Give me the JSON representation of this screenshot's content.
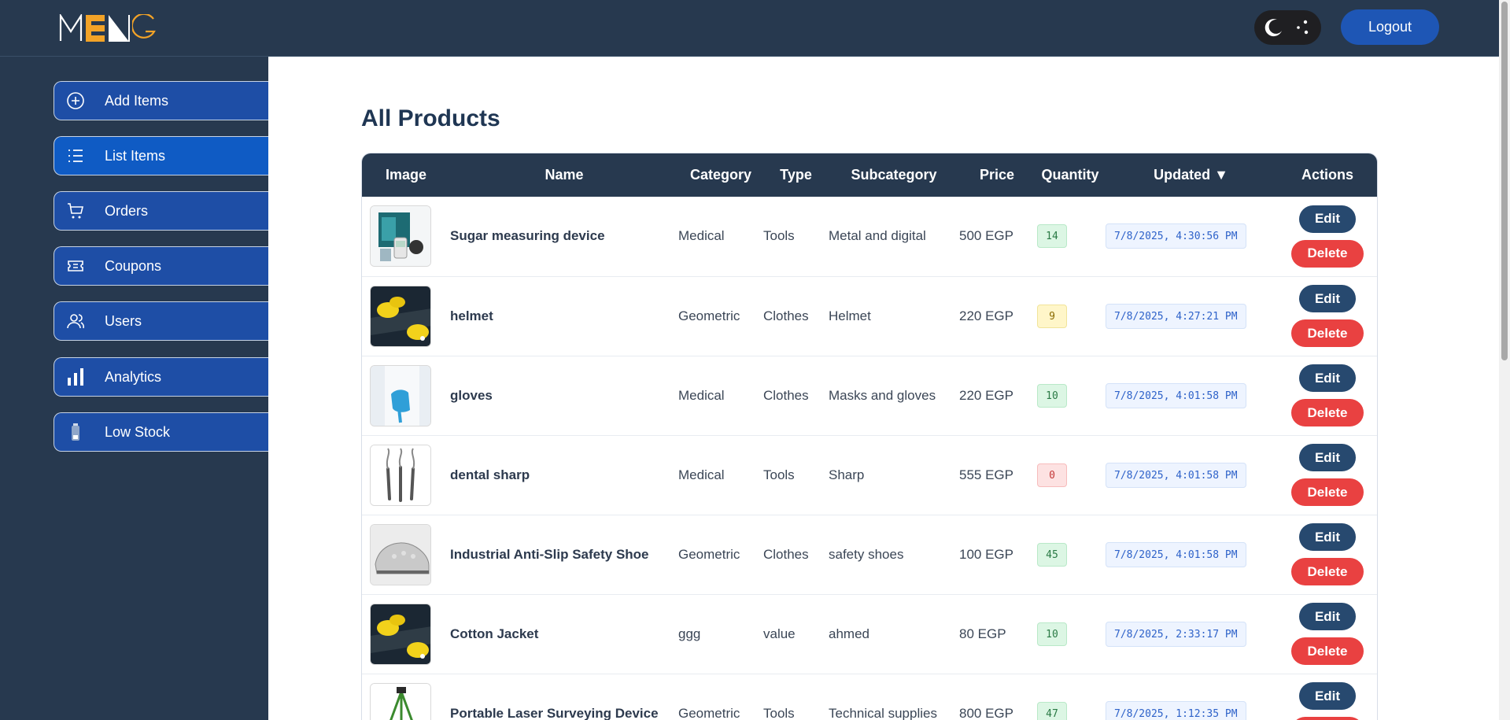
{
  "header": {
    "logout_label": "Logout"
  },
  "sidebar": {
    "items": [
      {
        "label": "Add Items",
        "icon": "plus-circle-icon"
      },
      {
        "label": "List Items",
        "icon": "list-icon"
      },
      {
        "label": "Orders",
        "icon": "cart-icon"
      },
      {
        "label": "Coupons",
        "icon": "ticket-icon"
      },
      {
        "label": "Users",
        "icon": "users-icon"
      },
      {
        "label": "Analytics",
        "icon": "bar-chart-icon"
      },
      {
        "label": "Low Stock",
        "icon": "battery-low-icon"
      }
    ]
  },
  "main": {
    "title": "All Products",
    "columns": [
      "Image",
      "Name",
      "Category",
      "Type",
      "Subcategory",
      "Price",
      "Quantity",
      "Updated ▼",
      "Actions"
    ],
    "edit_label": "Edit",
    "delete_label": "Delete",
    "rows": [
      {
        "name": "Sugar measuring device",
        "category": "Medical",
        "type": "Tools",
        "subcategory": "Metal and digital",
        "price": "500 EGP",
        "quantity": "14",
        "stock": "ok",
        "updated": "7/8/2025, 4:30:56 PM",
        "thumb": "glucometer-kit"
      },
      {
        "name": "helmet",
        "category": "Geometric",
        "type": "Clothes",
        "subcategory": "Helmet",
        "price": "220 EGP",
        "quantity": "9",
        "stock": "low",
        "updated": "7/8/2025, 4:27:21 PM",
        "thumb": "yellow-helmets"
      },
      {
        "name": "gloves",
        "category": "Medical",
        "type": "Clothes",
        "subcategory": "Masks and gloves",
        "price": "220 EGP",
        "quantity": "10",
        "stock": "ok",
        "updated": "7/8/2025, 4:01:58 PM",
        "thumb": "blue-gloves"
      },
      {
        "name": "dental sharp",
        "category": "Medical",
        "type": "Tools",
        "subcategory": "Sharp",
        "price": "555 EGP",
        "quantity": "0",
        "stock": "out",
        "updated": "7/8/2025, 4:01:58 PM",
        "thumb": "dental-tools"
      },
      {
        "name": "Industrial Anti-Slip Safety Shoe",
        "category": "Geometric",
        "type": "Clothes",
        "subcategory": "safety shoes",
        "price": "100 EGP",
        "quantity": "45",
        "stock": "ok",
        "updated": "7/8/2025, 4:01:58 PM",
        "thumb": "safety-shoe"
      },
      {
        "name": "Cotton Jacket",
        "category": "ggg",
        "type": "value",
        "subcategory": "ahmed",
        "price": "80 EGP",
        "quantity": "10",
        "stock": "ok",
        "updated": "7/8/2025, 2:33:17 PM",
        "thumb": "yellow-helmets"
      },
      {
        "name": "Portable Laser Surveying Device",
        "category": "Geometric",
        "type": "Tools",
        "subcategory": "Technical supplies",
        "price": "800 EGP",
        "quantity": "47",
        "stock": "ok",
        "updated": "7/8/2025, 1:12:35 PM",
        "thumb": "tripod"
      }
    ]
  }
}
